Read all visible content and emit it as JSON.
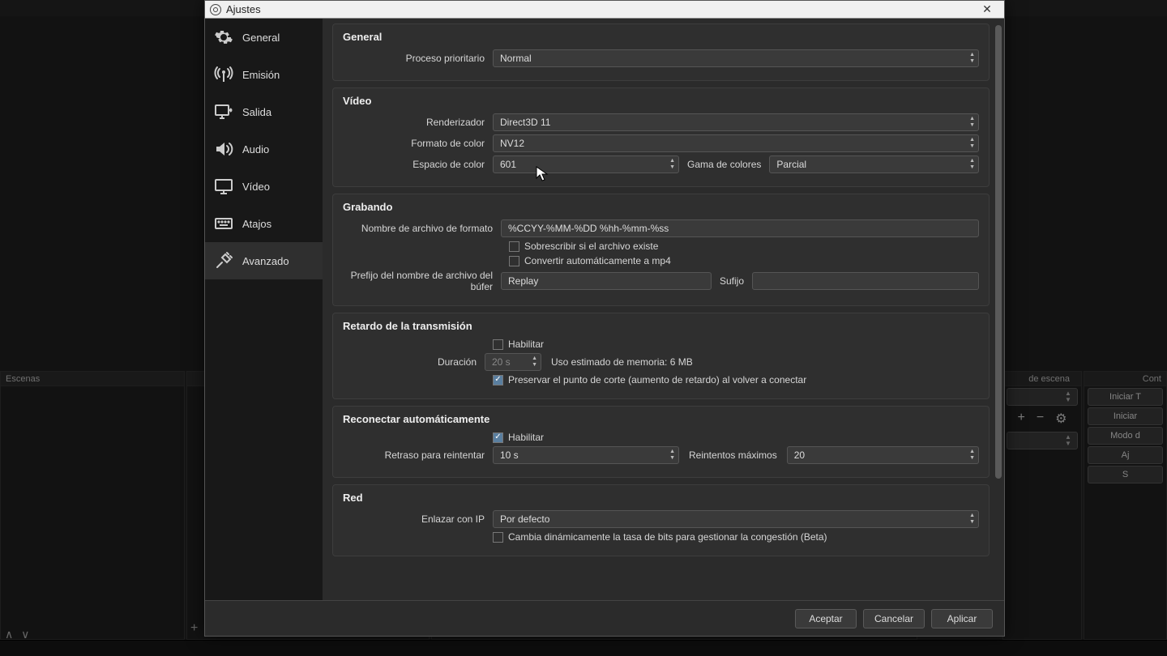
{
  "bg": {
    "scenes_dock": "Escenas",
    "filter_dock": "de escena",
    "controls_dock": "Cont",
    "ctl_buttons": [
      "Iniciar T",
      "Iniciar ",
      "Modo d",
      "Aj",
      "S"
    ]
  },
  "dialog": {
    "title": "Ajustes",
    "categories": [
      {
        "id": "general",
        "label": "General"
      },
      {
        "id": "stream",
        "label": "Emisión"
      },
      {
        "id": "output",
        "label": "Salida"
      },
      {
        "id": "audio",
        "label": "Audio"
      },
      {
        "id": "video",
        "label": "Vídeo"
      },
      {
        "id": "hotkeys",
        "label": "Atajos"
      },
      {
        "id": "advanced",
        "label": "Avanzado"
      }
    ],
    "buttons": {
      "ok": "Aceptar",
      "cancel": "Cancelar",
      "apply": "Aplicar"
    }
  },
  "general": {
    "heading": "General",
    "priority_label": "Proceso prioritario",
    "priority_value": "Normal"
  },
  "video": {
    "heading": "Vídeo",
    "renderer_label": "Renderizador",
    "renderer_value": "Direct3D 11",
    "colorfmt_label": "Formato de color",
    "colorfmt_value": "NV12",
    "colorspace_label": "Espacio de color",
    "colorspace_value": "601",
    "colorrange_label": "Gama de colores",
    "colorrange_value": "Parcial"
  },
  "recording": {
    "heading": "Grabando",
    "filename_label": "Nombre de archivo de formato",
    "filename_value": "%CCYY-%MM-%DD %hh-%mm-%ss",
    "overwrite_label": "Sobrescribir si el archivo existe",
    "automp4_label": "Convertir automáticamente a mp4",
    "prefix_label": "Prefijo del nombre de archivo del búfer",
    "prefix_value": "Replay",
    "suffix_label": "Sufijo",
    "suffix_value": ""
  },
  "delay": {
    "heading": "Retardo de la transmisión",
    "enable_label": "Habilitar",
    "duration_label": "Duración",
    "duration_value": "20 s",
    "memest_label": "Uso estimado de memoria: 6 MB",
    "preserve_label": "Preservar el punto de corte (aumento de retardo) al volver a conectar"
  },
  "reconnect": {
    "heading": "Reconectar automáticamente",
    "enable_label": "Habilitar",
    "retry_label": "Retraso para reintentar",
    "retry_value": "10 s",
    "maxretry_label": "Reintentos máximos",
    "maxretry_value": "20"
  },
  "network": {
    "heading": "Red",
    "bindip_label": "Enlazar con IP",
    "bindip_value": "Por defecto",
    "dynbitrate_label": "Cambia dinámicamente la tasa de bits para gestionar la congestión (Beta)"
  }
}
